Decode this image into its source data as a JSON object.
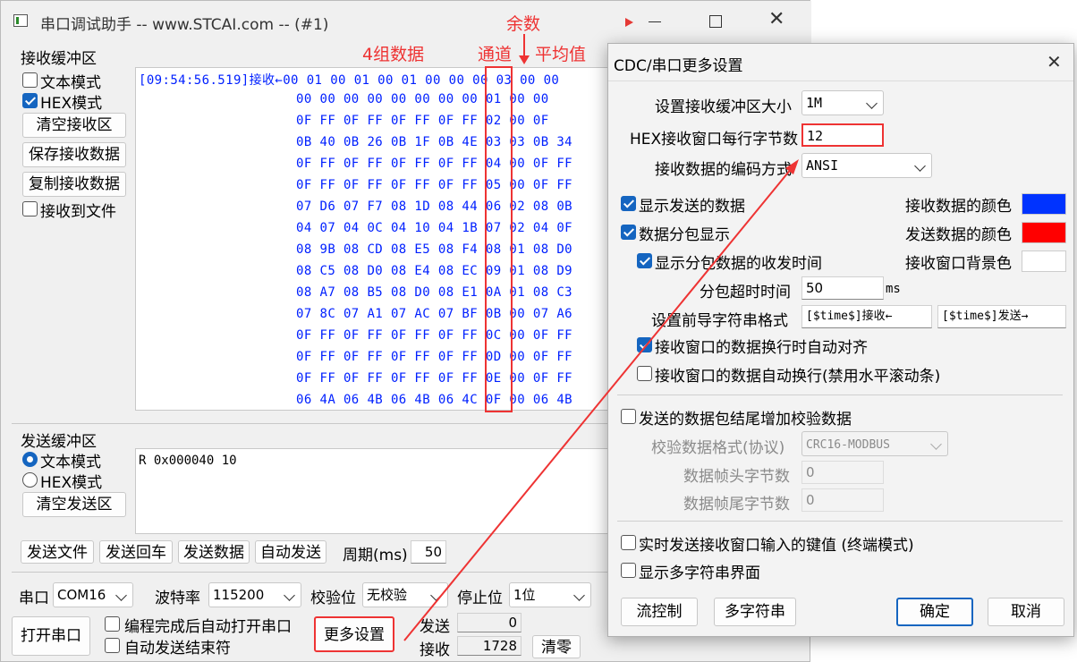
{
  "main_window": {
    "title": "串口调试助手 -- www.STCAI.com -- (#1)",
    "receive_group": "接收缓冲区",
    "text_mode": "文本模式",
    "hex_mode": "HEX模式",
    "clear_receive": "清空接收区",
    "save_receive": "保存接收数据",
    "copy_receive": "复制接收数据",
    "receive_to_file": "接收到文件",
    "timestamp_line": "[09:54:56.519]接收←00 01 00 01 00 01 00 00 00 03 00 00",
    "hex_rows": [
      "00 00 00 00 00 00 00 00 01 00 00",
      "0F FF 0F FF 0F FF 0F FF 02 00 0F",
      "0B 40 0B 26 0B 1F 0B 4E 03 03 0B 34",
      "0F FF 0F FF 0F FF 0F FF 04 00 0F FF",
      "0F FF 0F FF 0F FF 0F FF 05 00 0F FF",
      "07 D6 07 F7 08 1D 08 44 06 02 08 0B",
      "04 07 04 0C 04 10 04 1B 07 02 04 0F",
      "08 9B 08 CD 08 E5 08 F4 08 01 08 D0",
      "08 C5 08 D0 08 E4 08 EC 09 01 08 D9",
      "08 A7 08 B5 08 D0 08 E1 0A 01 08 C3",
      "07 8C 07 A1 07 AC 07 BF 0B 00 07 A6",
      "0F FF 0F FF 0F FF 0F FF 0C 00 0F FF",
      "0F FF 0F FF 0F FF 0F FF 0D 00 0F FF",
      "0F FF 0F FF 0F FF 0F FF 0E 00 0F FF",
      "06 4A 06 4B 06 4B 06 4C 0F 00 06 4B"
    ],
    "send_group": "发送缓冲区",
    "send_text_mode": "文本模式",
    "send_hex_mode": "HEX模式",
    "clear_send": "清空发送区",
    "send_content": "R 0x000040 10",
    "send_file": "发送文件",
    "send_return": "发送回车",
    "send_data": "发送数据",
    "auto_send": "自动发送",
    "period_label": "周期(ms)",
    "period_value": "50",
    "port_label": "串口",
    "port_value": "COM16",
    "baud_label": "波特率",
    "baud_value": "115200",
    "parity_label": "校验位",
    "parity_value": "无校验",
    "stop_label": "停止位",
    "stop_value": "1位",
    "open_port": "打开串口",
    "auto_open": "编程完成后自动打开串口",
    "auto_end": "自动发送结束符",
    "more_settings": "更多设置",
    "sent_label": "发送",
    "sent_value": "0",
    "received_label": "接收",
    "received_value": "1728",
    "clear_counts": "清零"
  },
  "annotations": {
    "remainder": "余数",
    "four_groups": "4组数据",
    "channel": "通道",
    "average": "平均值"
  },
  "dialog": {
    "title": "CDC/串口更多设置",
    "buffer_size_label": "设置接收缓冲区大小",
    "buffer_size_value": "1M",
    "hex_bytes_label": "HEX接收窗口每行字节数",
    "hex_bytes_value": "12",
    "encoding_label": "接收数据的编码方式",
    "encoding_value": "ANSI",
    "show_sent": "显示发送的数据",
    "recv_color_label": "接收数据的颜色",
    "packet_display": "数据分包显示",
    "send_color_label": "发送数据的颜色",
    "show_packet_time": "显示分包数据的收发时间",
    "bg_color_label": "接收窗口背景色",
    "timeout_label": "分包超时时间",
    "timeout_value": "50",
    "timeout_unit": "ms",
    "prefix_label": "设置前导字符串格式",
    "prefix_recv": "[$time$]接收←",
    "prefix_send": "[$time$]发送→",
    "auto_align": "接收窗口的数据换行时自动对齐",
    "auto_wrap": "接收窗口的数据自动换行(禁用水平滚动条)",
    "checksum": "发送的数据包结尾增加校验数据",
    "checksum_format_label": "校验数据格式(协议)",
    "checksum_format_value": "CRC16-MODBUS",
    "header_bytes_label": "数据帧头字节数",
    "header_bytes_value": "0",
    "tail_bytes_label": "数据帧尾字节数",
    "tail_bytes_value": "0",
    "realtime_send": "实时发送接收窗口输入的键值 (终端模式)",
    "multi_string_ui": "显示多字符串界面",
    "flow_control": "流控制",
    "multi_string": "多字符串",
    "ok": "确定",
    "cancel": "取消"
  },
  "colors": {
    "recv_color": "#0033ff",
    "send_color": "#ff0000",
    "bg_color": "#ffffff",
    "accent": "#1565c0",
    "annotation_red": "#ee3333"
  }
}
